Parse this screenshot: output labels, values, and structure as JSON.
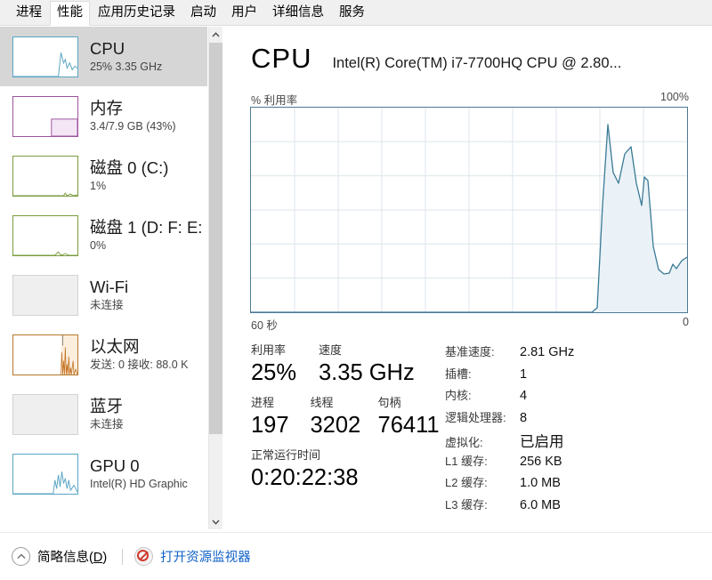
{
  "window": {
    "tabs": [
      {
        "label": "进程",
        "active": false
      },
      {
        "label": "性能",
        "active": true
      },
      {
        "label": "应用历史记录",
        "active": false
      },
      {
        "label": "启动",
        "active": false
      },
      {
        "label": "用户",
        "active": false
      },
      {
        "label": "详细信息",
        "active": false
      },
      {
        "label": "服务",
        "active": false
      }
    ]
  },
  "sidebar": {
    "items": [
      {
        "title": "CPU",
        "sub": "25% 3.35 GHz",
        "selected": true,
        "accent": "#5aa5c4",
        "kind": "line"
      },
      {
        "title": "内存",
        "sub": "3.4/7.9 GB (43%)",
        "selected": false,
        "accent": "#9c54a0",
        "kind": "memory"
      },
      {
        "title": "磁盘 0 (C:)",
        "sub": "1%",
        "selected": false,
        "accent": "#7a9c3f",
        "kind": "flat"
      },
      {
        "title": "磁盘 1 (D: F: E:",
        "sub": "0%",
        "selected": false,
        "accent": "#7a9c3f",
        "kind": "flat"
      },
      {
        "title": "Wi-Fi",
        "sub": "未连接",
        "selected": false,
        "accent": "#c8c8c8",
        "kind": "empty"
      },
      {
        "title": "以太网",
        "sub": "发送: 0 接收: 88.0 K",
        "selected": false,
        "accent": "#b5772a",
        "kind": "net"
      },
      {
        "title": "蓝牙",
        "sub": "未连接",
        "selected": false,
        "accent": "#c8c8c8",
        "kind": "empty"
      },
      {
        "title": "GPU 0",
        "sub": "Intel(R) HD Graphic",
        "selected": false,
        "accent": "#5aa5c4",
        "kind": "gpu"
      }
    ]
  },
  "detail": {
    "title": "CPU",
    "subtitle": "Intel(R) Core(TM) i7-7700HQ CPU @ 2.80...",
    "axis_label": "% 利用率",
    "axis_max": "100%",
    "time_left": "60 秒",
    "time_right": "0",
    "stats": {
      "utilization_label": "利用率",
      "utilization_value": "25%",
      "speed_label": "速度",
      "speed_value": "3.35 GHz",
      "processes_label": "进程",
      "processes_value": "197",
      "threads_label": "线程",
      "threads_value": "3202",
      "handles_label": "句柄",
      "handles_value": "76411",
      "uptime_label": "正常运行时间",
      "uptime_value": "0:20:22:38"
    },
    "specs": [
      {
        "label": "基准速度:",
        "value": "2.81 GHz",
        "big": false
      },
      {
        "label": "插槽:",
        "value": "1",
        "big": false
      },
      {
        "label": "内核:",
        "value": "4",
        "big": false
      },
      {
        "label": "逻辑处理器:",
        "value": "8",
        "big": false
      },
      {
        "label": "虚拟化:",
        "value": "已启用",
        "big": true
      },
      {
        "label": "L1 缓存:",
        "value": "256 KB",
        "big": false
      },
      {
        "label": "L2 缓存:",
        "value": "1.0 MB",
        "big": false
      },
      {
        "label": "L3 缓存:",
        "value": "6.0 MB",
        "big": false
      }
    ]
  },
  "footer": {
    "fewer_details_pre": "简略信息(",
    "fewer_details_key": "D",
    "fewer_details_post": ")",
    "resource_monitor": "打开资源监视器"
  },
  "chart_data": {
    "type": "area",
    "title": "CPU 利用率",
    "ylabel": "% 利用率",
    "xlabel": "60 秒",
    "ylim": [
      0,
      100
    ],
    "xlim": [
      60,
      0
    ],
    "grid": true,
    "grid_cols": 10,
    "grid_rows": 6,
    "line_color": "#3a7a96",
    "fill_color": "#eaf2f7",
    "x": [
      60,
      52,
      51,
      50,
      49,
      48,
      47,
      46,
      45,
      44,
      43,
      42,
      41,
      40,
      39,
      38,
      37,
      36,
      35,
      34,
      33,
      32,
      31,
      30,
      29,
      28,
      27,
      26,
      25,
      24,
      23,
      22,
      21,
      20,
      19,
      18,
      17,
      16,
      15,
      14,
      13,
      12,
      11,
      10,
      9,
      8,
      7,
      6,
      5,
      4,
      3,
      2,
      1,
      0
    ],
    "values": [
      0,
      0,
      0,
      0,
      0,
      0,
      0,
      0,
      0,
      0,
      0,
      0,
      0,
      0,
      0,
      0,
      0,
      0,
      0,
      0,
      0,
      0,
      0,
      0,
      0,
      0,
      0,
      0,
      0,
      0,
      0,
      0,
      0,
      0,
      0,
      0,
      0,
      0,
      2,
      52,
      95,
      70,
      60,
      74,
      82,
      58,
      45,
      62,
      55,
      27,
      17,
      16,
      22,
      19,
      26
    ]
  }
}
